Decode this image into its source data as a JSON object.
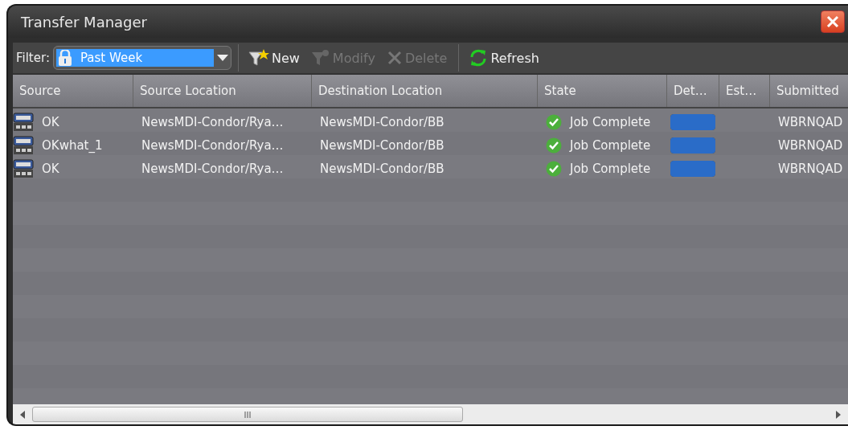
{
  "window": {
    "title": "Transfer Manager"
  },
  "toolbar": {
    "filter_label": "Filter:",
    "filter": {
      "value": "Past Week"
    },
    "buttons": [
      {
        "kind": "new",
        "label": "New",
        "disabled": false
      },
      {
        "kind": "modify",
        "label": "Modify",
        "disabled": true
      },
      {
        "kind": "delete",
        "label": "Delete",
        "disabled": true
      },
      {
        "kind": "refresh",
        "label": "Refresh",
        "disabled": false
      }
    ]
  },
  "table": {
    "columns": [
      "Source",
      "Source Location",
      "Destination Location",
      "State",
      "Det…",
      "Est…",
      "Submitted"
    ],
    "rows": [
      {
        "source": "OK",
        "source_location": "NewsMDI-Condor/Rya…",
        "destination_location": "NewsMDI-Condor/BB",
        "state": "Job Complete",
        "level": 1,
        "submitted_by": "WBRNQAD"
      },
      {
        "source": "OKwhat_1",
        "source_location": "NewsMDI-Condor/Rya…",
        "destination_location": "NewsMDI-Condor/BB",
        "state": "Job Complete",
        "level": 1,
        "submitted_by": "WBRNQAD"
      },
      {
        "source": "OK",
        "source_location": "NewsMDI-Condor/Rya…",
        "destination_location": "NewsMDI-Condor/BB",
        "state": "Job Complete",
        "level": 1,
        "submitted_by": "WBRNQAD"
      }
    ]
  }
}
